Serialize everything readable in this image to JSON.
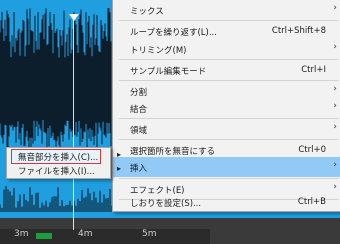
{
  "colors": {
    "wave_bg": "#1f9fe0",
    "wave": "#0a0f18",
    "menu_bg": "#f2f2f2",
    "highlight": "#91c9f7",
    "accent_box": "#d23a3a"
  },
  "timeline": {
    "labels": [
      "3m",
      "4m",
      "5m"
    ]
  },
  "context_menu": {
    "items": [
      {
        "label": "ミックス",
        "shortcut": "",
        "has_submenu": true
      },
      {
        "label": "ループを繰り返す(L)...",
        "shortcut": "Ctrl+Shift+8",
        "has_submenu": false
      },
      {
        "label": "トリミング(M)",
        "shortcut": "",
        "has_submenu": true
      },
      {
        "label": "サンプル編集モード",
        "shortcut": "Ctrl+I",
        "has_submenu": false
      },
      {
        "label": "分割",
        "shortcut": "",
        "has_submenu": true
      },
      {
        "label": "結合",
        "shortcut": "",
        "has_submenu": true
      },
      {
        "label": "領域",
        "shortcut": "",
        "has_submenu": true
      },
      {
        "label": "選択箇所を無音にする",
        "shortcut": "Ctrl+0",
        "has_submenu": false
      },
      {
        "label": "挿入",
        "shortcut": "",
        "has_submenu": true,
        "highlighted": true
      },
      {
        "label": "エフェクト(E)",
        "shortcut": "",
        "has_submenu": true
      },
      {
        "label": "しおりを設定(S)...",
        "shortcut": "Ctrl+B",
        "has_submenu": false
      }
    ]
  },
  "insert_submenu": {
    "items": [
      {
        "label": "無音部分を挿入(C)...",
        "has_submenu": true
      },
      {
        "label": "ファイルを挿入(I)...",
        "has_submenu": true
      }
    ]
  }
}
